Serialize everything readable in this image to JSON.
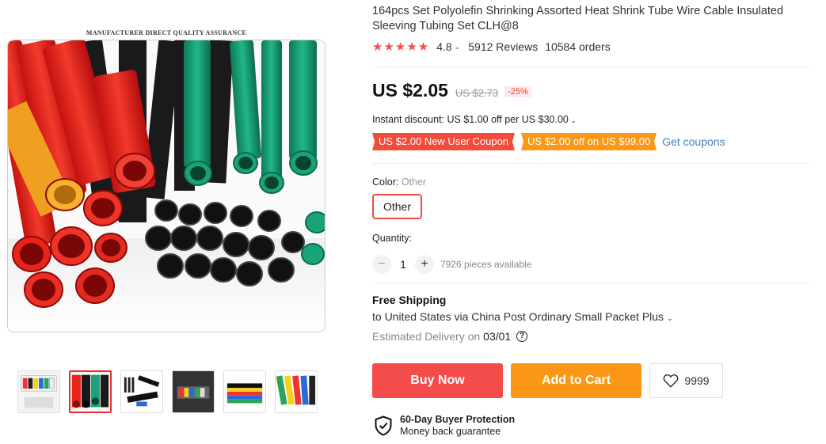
{
  "gallery": {
    "caption": "MANUFACTURER DIRECT QUALITY ASSURANCE",
    "main_image": "heat-shrink-tubes-red-black-green",
    "thumbnails": [
      "assorted-tubes-box",
      "red-black-green-tubes",
      "black-tubes-heatgun",
      "colored-tube-kit",
      "color-tube-stack",
      "colored-tubes-closeup"
    ],
    "active_thumbnail": 1
  },
  "product": {
    "title": "164pcs Set Polyolefin Shrinking Assorted Heat Shrink Tube Wire Cable Insulated Sleeving Tubing Set CLH@8",
    "stars": "★★★★★",
    "rating": "4.8",
    "reviews": "5912 Reviews",
    "orders": "10584 orders"
  },
  "price": {
    "current": "US $2.05",
    "original": "US $2.73",
    "discount": "-25%",
    "instant_discount": "Instant discount: US $1.00 off per US $30.00"
  },
  "coupons": {
    "new_user": "US $2.00 New User Coupon",
    "threshold": "US $2.00 off on US $99.00",
    "get_link": "Get coupons"
  },
  "variant": {
    "color_label": "Color: ",
    "color_value": "Other",
    "option": "Other"
  },
  "quantity": {
    "label": "Quantity:",
    "value": "1",
    "minus": "−",
    "plus": "+",
    "available": "7926 pieces available"
  },
  "shipping": {
    "title": "Free Shipping",
    "to": "to United States via China Post Ordinary Small Packet Plus",
    "delivery_label": "Estimated Delivery on",
    "delivery_date": "03/01",
    "help": "?"
  },
  "actions": {
    "buy_now": "Buy Now",
    "add_to_cart": "Add to Cart",
    "wishlist_count": "9999"
  },
  "protection": {
    "title": "60-Day Buyer Protection",
    "subtitle": "Money back guarantee"
  },
  "colors": {
    "accent_red": "#f44b4b",
    "accent_orange": "#fb9617",
    "link_blue": "#3e80bd"
  }
}
